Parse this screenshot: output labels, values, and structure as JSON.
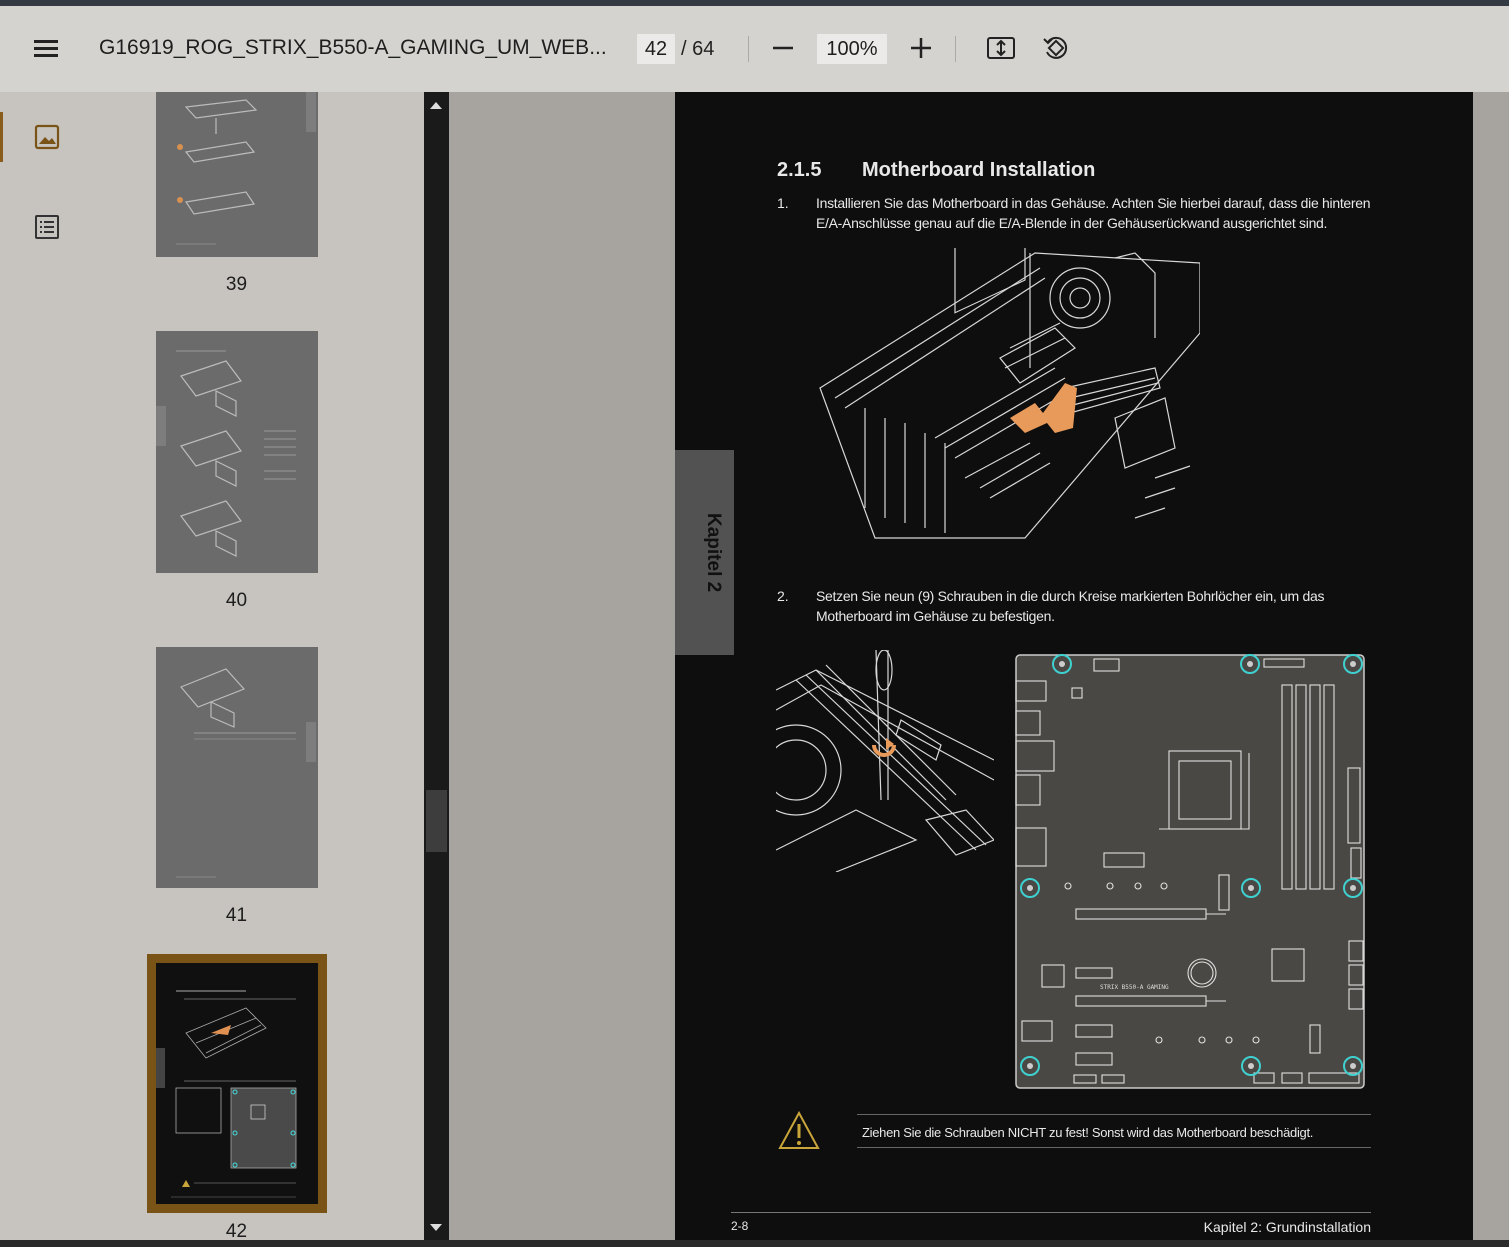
{
  "toolbar": {
    "title": "G16919_ROG_STRIX_B550-A_GAMING_UM_WEB...",
    "page_current": "42",
    "page_total": "/ 64",
    "zoom": "100%"
  },
  "thumbnails": [
    {
      "label": "39"
    },
    {
      "label": "40"
    },
    {
      "label": "41"
    },
    {
      "label": "42"
    }
  ],
  "page": {
    "chapter_tab": "Kapitel 2",
    "section_number": "2.1.5",
    "section_title": "Motherboard Installation",
    "steps": [
      {
        "num": "1.",
        "text": "Installieren Sie das Motherboard in das Gehäuse. Achten Sie hierbei darauf, dass die hinteren E/A-Anschlüsse genau auf die E/A-Blende in der Gehäuserückwand ausgerichtet sind."
      },
      {
        "num": "2.",
        "text": "Setzen Sie neun (9) Schrauben in die durch Kreise markierten Bohrlöcher ein, um das Motherboard im Gehäuse zu befestigen."
      }
    ],
    "board_label": "STRIX B550-A GAMING",
    "warning": "Ziehen Sie die Schrauben NICHT zu fest! Sonst wird das Motherboard beschädigt.",
    "footer_left": "2-8",
    "footer_right": "Kapitel 2: Grundinstallation"
  },
  "colors": {
    "accent": "#7a5416",
    "screw_ring": "#3fd0d0",
    "arrow": "#e89a5a"
  }
}
